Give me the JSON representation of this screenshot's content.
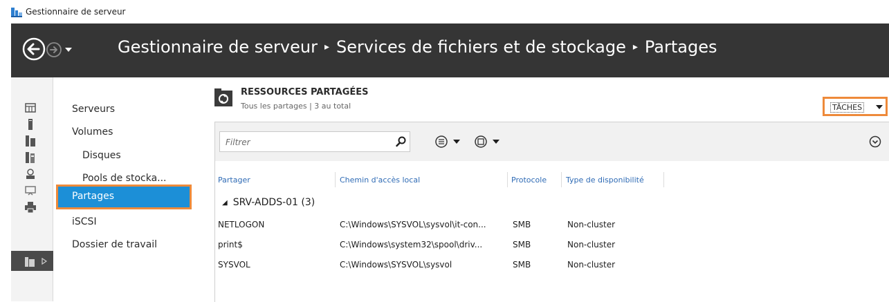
{
  "window": {
    "title": "Gestionnaire de serveur"
  },
  "breadcrumb": [
    "Gestionnaire de serveur",
    "Services de fichiers et de stockage",
    "Partages"
  ],
  "sidebar": {
    "items": [
      {
        "label": "Serveurs"
      },
      {
        "label": "Volumes"
      },
      {
        "label": "Disques"
      },
      {
        "label": "Pools de stocka..."
      },
      {
        "label": "Partages",
        "selected": true
      },
      {
        "label": "iSCSI"
      },
      {
        "label": "Dossier de travail"
      }
    ]
  },
  "rail": {
    "icons": [
      "dashboard-icon",
      "local-server-icon",
      "all-servers-icon",
      "adds-icon",
      "dns-icon",
      "hyper-v-icon",
      "print-icon",
      "file-storage-icon"
    ]
  },
  "main": {
    "heading": "RESSOURCES PARTAGÉES",
    "subheading": "Tous les partages | 3 au total",
    "tasks_label": "TÂCHES",
    "filter_placeholder": "Filtrer",
    "columns": [
      "Partager",
      "Chemin d'accès local",
      "Protocole",
      "Type de disponibilité"
    ],
    "group_label": "SRV-ADDS-01 (3)",
    "rows": [
      {
        "share": "NETLOGON",
        "path": "C:\\Windows\\SYSVOL\\sysvol\\it-con...",
        "protocol": "SMB",
        "availability": "Non-cluster"
      },
      {
        "share": "print$",
        "path": "C:\\Windows\\system32\\spool\\driv...",
        "protocol": "SMB",
        "availability": "Non-cluster"
      },
      {
        "share": "SYSVOL",
        "path": "C:\\Windows\\SYSVOL\\sysvol",
        "protocol": "SMB",
        "availability": "Non-cluster"
      }
    ]
  },
  "colors": {
    "navbar": "#353535",
    "selection": "#1c8fd7",
    "highlight": "#ee8a3a",
    "link": "#2f6bb5"
  }
}
